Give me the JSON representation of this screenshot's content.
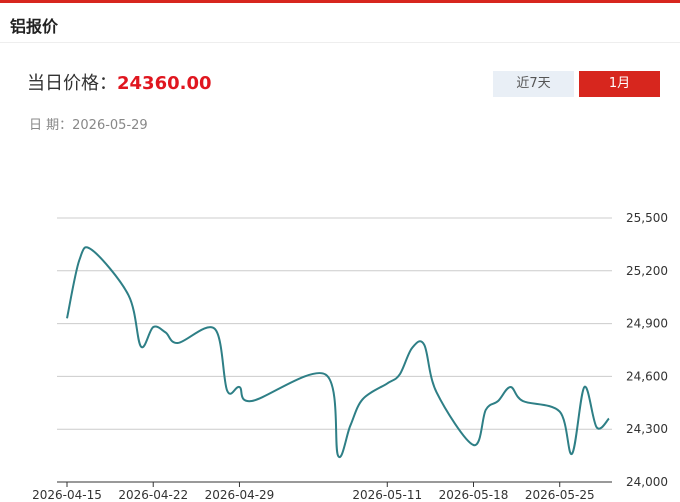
{
  "header": {
    "title": "铝报价"
  },
  "price": {
    "label": "当日价格：",
    "value": "24360.00"
  },
  "date": {
    "label": "日 期：",
    "value": "2026-05-29"
  },
  "range_buttons": [
    {
      "label": "近7天",
      "active": false
    },
    {
      "label": "1月",
      "active": true
    }
  ],
  "colors": {
    "accent": "#d7261e",
    "price": "#e0161f",
    "line": "#2e7f86",
    "grid": "#cccccc"
  },
  "chart_data": {
    "type": "line",
    "title": "",
    "xlabel": "",
    "ylabel": "",
    "ylim": [
      24000,
      25500
    ],
    "yticks": [
      24000,
      24300,
      24600,
      24900,
      25200,
      25500
    ],
    "ytick_labels": [
      "24,000",
      "24,300",
      "24,600",
      "24,900",
      "25,200",
      "25,500"
    ],
    "xtick_labels": [
      "2026-04-15",
      "2026-04-22",
      "2026-04-29",
      "2026-05-11",
      "2026-05-18",
      "2026-05-25"
    ],
    "grid": true,
    "series": [
      {
        "name": "",
        "x": [
          "2026-04-15",
          "2026-04-16",
          "2026-04-17",
          "2026-04-20",
          "2026-04-21",
          "2026-04-22",
          "2026-04-23",
          "2026-04-24",
          "2026-04-27",
          "2026-04-28",
          "2026-04-29",
          "2026-04-30",
          "2026-05-06",
          "2026-05-07",
          "2026-05-08",
          "2026-05-09",
          "2026-05-11",
          "2026-05-12",
          "2026-05-13",
          "2026-05-14",
          "2026-05-15",
          "2026-05-18",
          "2026-05-19",
          "2026-05-20",
          "2026-05-21",
          "2026-05-22",
          "2026-05-25",
          "2026-05-26",
          "2026-05-27",
          "2026-05-28",
          "2026-05-29"
        ],
        "values": [
          24930,
          25260,
          25320,
          25060,
          24770,
          24880,
          24850,
          24790,
          24870,
          24520,
          24540,
          24460,
          24610,
          24150,
          24320,
          24470,
          24560,
          24610,
          24760,
          24780,
          24510,
          24210,
          24410,
          24460,
          24540,
          24460,
          24400,
          24160,
          24540,
          24310,
          24360
        ]
      }
    ]
  }
}
